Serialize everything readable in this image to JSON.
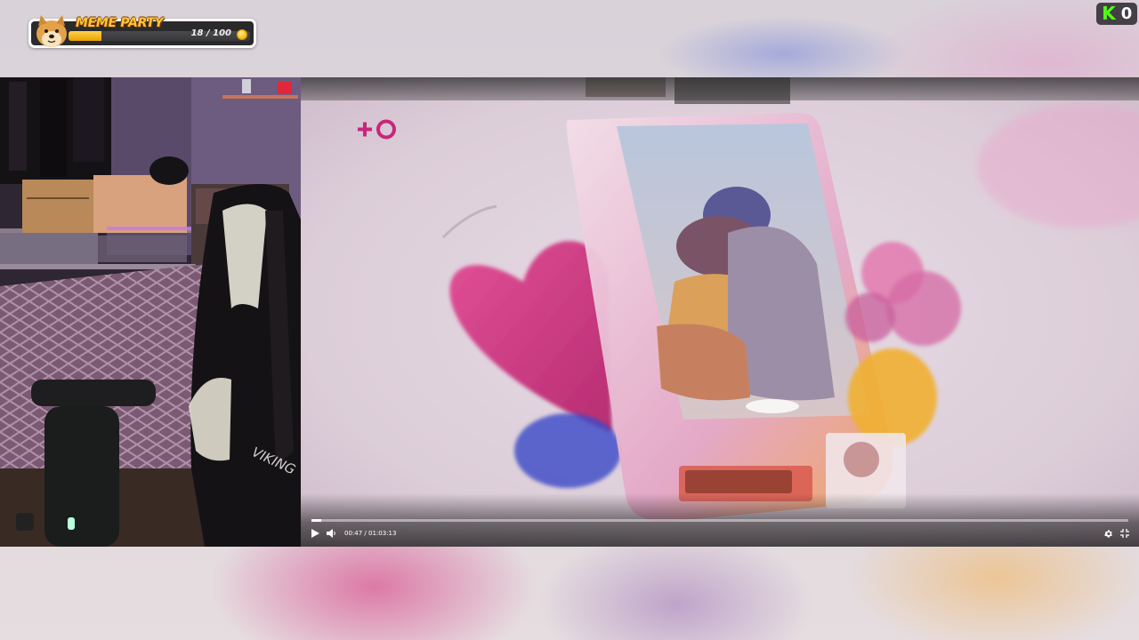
{
  "meme_widget": {
    "title": "MEME PARTY",
    "current": 18,
    "total": 100,
    "count_text": "18 / 100",
    "progress_fraction": 0.18,
    "avatar_icon": "doge-icon",
    "coin_icon": "coin-icon"
  },
  "kick_badge": {
    "logo_letter": "K",
    "count": "0",
    "logo_color": "#53fc18"
  },
  "player": {
    "current_time": "00:47",
    "duration": "01:03:13",
    "time_separator": "/",
    "progress_fraction": 0.0124,
    "play_icon": "play-icon",
    "volume_icon": "volume-icon",
    "settings_icon": "gear-icon",
    "fullscreen_icon": "exit-fullscreen-icon"
  },
  "webcam": {
    "chair_brand": "VIKING"
  },
  "colors": {
    "meme_accent": "#ffc53a",
    "kick_green": "#53fc18",
    "heart_magenta": "#d81e74"
  }
}
